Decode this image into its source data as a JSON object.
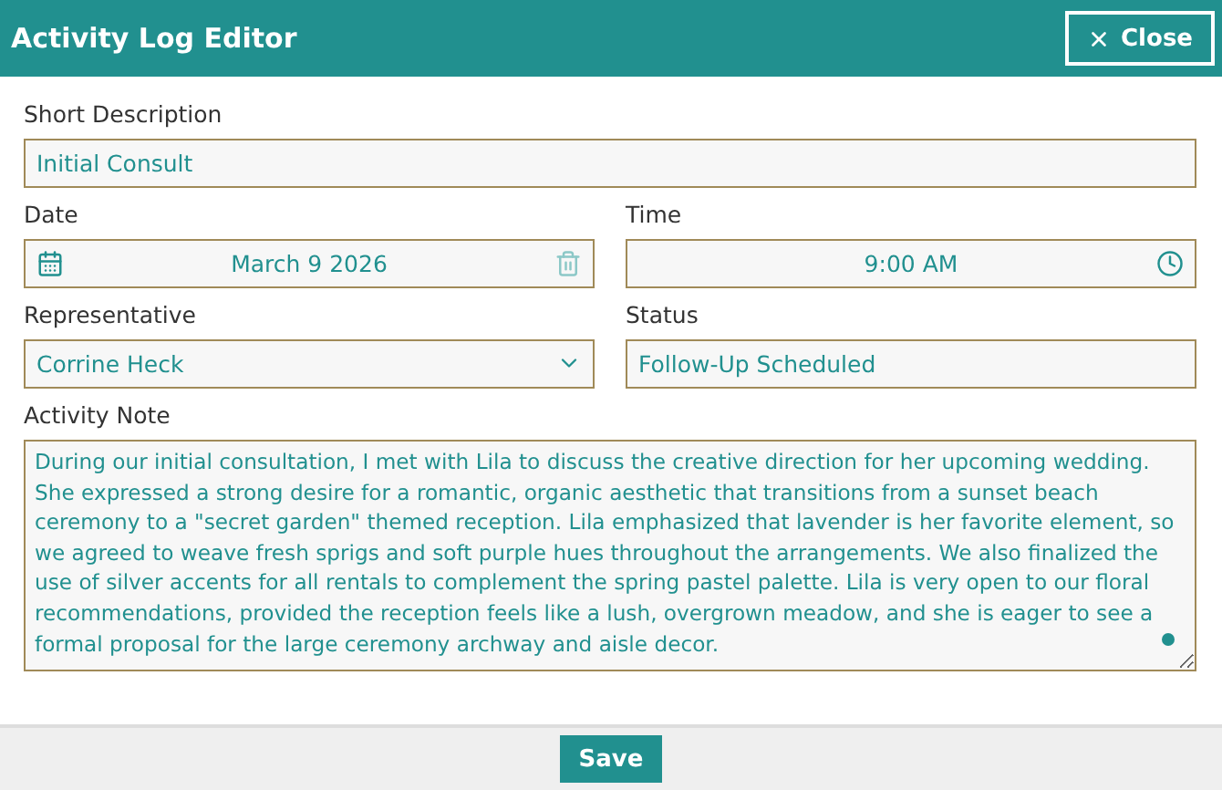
{
  "window": {
    "title": "Activity Log Editor",
    "close_button": "Close"
  },
  "short_description": {
    "label": "Short Description",
    "value": "Initial Consult"
  },
  "date": {
    "label": "Date",
    "value": "March 9 2026"
  },
  "time": {
    "label": "Time",
    "value": "9:00 AM"
  },
  "representative": {
    "label": "Representative",
    "value": "Corrine Heck"
  },
  "status": {
    "label": "Status",
    "value": "Follow-Up Scheduled"
  },
  "activity_note": {
    "label": "Activity Note",
    "value": "During our initial consultation, I met with Lila to discuss the creative direction for her upcoming wedding. She expressed a strong desire for a romantic, organic aesthetic that transitions from a sunset beach ceremony to a \"secret garden\" themed reception. Lila emphasized that lavender is her favorite element, so we agreed to weave fresh sprigs and soft purple hues throughout the arrangements. We also finalized the use of silver accents for all rentals to complement the spring pastel palette. Lila is very open to our floral recommendations, provided the reception feels like a lush, overgrown meadow, and she is eager to see a formal proposal for the large ceremony archway and aisle decor."
  },
  "footer": {
    "save_button": "Save"
  }
}
